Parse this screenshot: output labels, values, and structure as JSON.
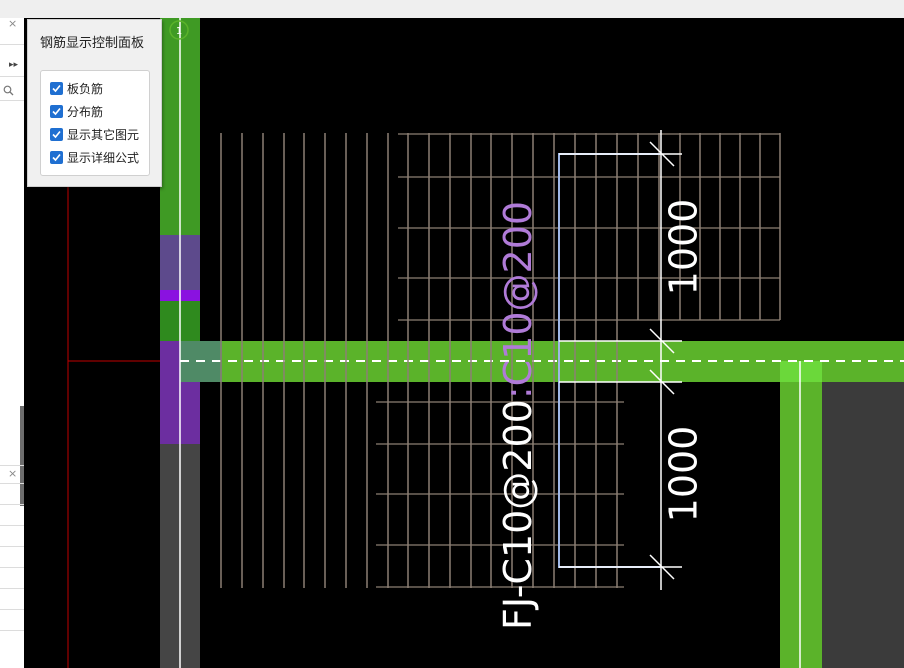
{
  "window": {
    "close_glyph": "×"
  },
  "left_panel": {
    "expand_glyph": "▸▸",
    "search_icon": "search-icon"
  },
  "control_panel": {
    "title": "钢筋显示控制面板",
    "checkboxes": [
      {
        "label": "板负筋",
        "checked": true
      },
      {
        "label": "分布筋",
        "checked": true
      },
      {
        "label": "显示其它图元",
        "checked": true
      },
      {
        "label": "显示详细公式",
        "checked": true
      }
    ]
  },
  "drawing": {
    "rebar_label_parts": [
      "FJ-C10@200",
      ":",
      "C10@200"
    ],
    "dimension_values": [
      "1000",
      "1000"
    ],
    "axis_marker_glyph": "1",
    "colors": {
      "background": "#000000",
      "beam_green": "#5bb32a",
      "beam_green_dark": "#3f9a24",
      "purple": "#6c2ea0",
      "grid_line": "#8c7f74",
      "dimension_white": "#ffffff",
      "rebar_blue": "#9fb7e6",
      "label_purple": "#b07bd8",
      "red_axis": "#c00000"
    }
  }
}
